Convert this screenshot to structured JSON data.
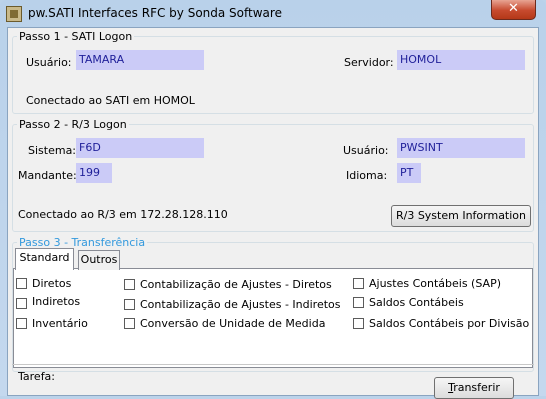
{
  "window": {
    "title": "pw.SATI Interfaces RFC by Sonda Software",
    "close_glyph": "✕"
  },
  "passo1": {
    "legend": "Passo 1 - SATI Logon",
    "usuario_label": "Usuário:",
    "usuario_value": "TAMARA",
    "servidor_label": "Servidor:",
    "servidor_value": "HOMOL",
    "status": "Conectado ao SATI em HOMOL"
  },
  "passo2": {
    "legend": "Passo 2 - R/3 Logon",
    "sistema_label": "Sistema:",
    "sistema_value": "F6D",
    "usuario_label": "Usuário:",
    "usuario_value": "PWSINT",
    "mandante_label": "Mandante:",
    "mandante_value": "199",
    "idioma_label": "Idioma:",
    "idioma_value": "PT",
    "status": "Conectado ao R/3 em 172.28.128.110",
    "sysinfo_button": "R/3 System Information"
  },
  "passo3": {
    "legend": "Passo 3 - Transferência",
    "legend_color": "#3399dd",
    "tabs": [
      "Standard",
      "Outros"
    ],
    "col1": [
      "Diretos",
      "Indiretos",
      "Inventário"
    ],
    "col2": [
      "Contabilização de Ajustes - Diretos",
      "Contabilização de Ajustes - Indiretos",
      "Conversão de Unidade de Medida"
    ],
    "col3": [
      "Ajustes Contábeis (SAP)",
      "Saldos Contábeis",
      "Saldos Contábeis por Divisão"
    ]
  },
  "footer": {
    "tarefa_label": "Tarefa:",
    "transferir_first": "T",
    "transferir_rest": "ransferir"
  }
}
